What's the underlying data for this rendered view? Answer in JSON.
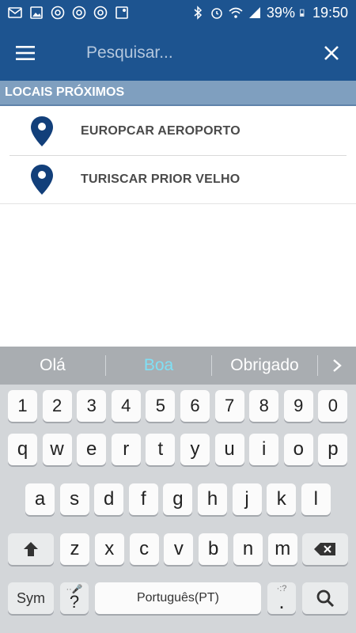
{
  "status_bar": {
    "battery": "39%",
    "time": "19:50"
  },
  "app_bar": {
    "menu_icon": "hamburger-menu-icon",
    "search_placeholder": "Pesquisar...",
    "close_icon": "close-icon"
  },
  "section": {
    "title": "LOCAIS PRÓXIMOS"
  },
  "locations": [
    {
      "name": "EUROPCAR AEROPORTO",
      "icon": "location-pin-icon"
    },
    {
      "name": "TURISCAR PRIOR VELHO",
      "icon": "location-pin-icon"
    }
  ],
  "keyboard": {
    "suggestions": [
      "Olá",
      "Boa",
      "Obrigado"
    ],
    "selected_suggestion": "Boa",
    "row_numbers": [
      "1",
      "2",
      "3",
      "4",
      "5",
      "6",
      "7",
      "8",
      "9",
      "0"
    ],
    "row1": [
      "q",
      "w",
      "e",
      "r",
      "t",
      "y",
      "u",
      "i",
      "o",
      "p"
    ],
    "row2": [
      "a",
      "s",
      "d",
      "f",
      "g",
      "h",
      "j",
      "k",
      "l"
    ],
    "row3": [
      "z",
      "x",
      "c",
      "v",
      "b",
      "n",
      "m"
    ],
    "sym_label": "Sym",
    "question_key": "?",
    "space_label": "Português(PT)",
    "period_key": ".",
    "shift_icon": "shift-icon",
    "backspace_icon": "backspace-icon",
    "search_icon": "search-icon"
  },
  "colors": {
    "primary": "#1d5490",
    "section_header": "#7f9fbf",
    "pin": "#123f7a",
    "suggestion_selected": "#7fe0f5"
  }
}
